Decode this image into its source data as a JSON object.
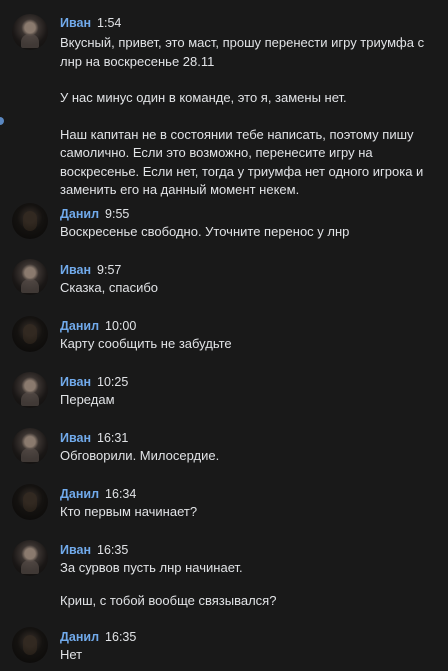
{
  "messages": [
    {
      "author": "Иван",
      "time": "1:54",
      "paragraphs": [
        "Вкусный, привет, это маст, прошу перенести игру триумфа с лнр на воскресенье 28.11",
        "У нас минус один в команде, это я, замены нет.",
        "Наш капитан не в состоянии тебе написать, поэтому пишу самолично. Если это возможно, перенесите игру на воскресенье. Если нет, тогда у триумфа нет одного игрока и заменить его на данный момент некем."
      ]
    },
    {
      "author": "Данил",
      "time": "9:55",
      "paragraphs": [
        "Воскресенье свободно. Уточните перенос у лнр"
      ]
    },
    {
      "author": "Иван",
      "time": "9:57",
      "paragraphs": [
        "Сказка, спасибо"
      ]
    },
    {
      "author": "Данил",
      "time": "10:00",
      "paragraphs": [
        "Карту сообщить не забудьте"
      ]
    },
    {
      "author": "Иван",
      "time": "10:25",
      "paragraphs": [
        "Передам"
      ]
    },
    {
      "author": "Иван",
      "time": "16:31",
      "paragraphs": [
        "Обговорили. Милосердие."
      ]
    },
    {
      "author": "Данил",
      "time": "16:34",
      "paragraphs": [
        "Кто первым начинает?"
      ]
    },
    {
      "author": "Иван",
      "time": "16:35",
      "paragraphs": [
        "За сурвов пусть лнр начинает.",
        "Криш, с тобой вообще связывался?"
      ]
    },
    {
      "author": "Данил",
      "time": "16:35",
      "paragraphs": [
        "Нет"
      ]
    }
  ],
  "colors": {
    "background": "#191919",
    "author_name": "#71aaeb",
    "text": "#e1e3e6"
  }
}
